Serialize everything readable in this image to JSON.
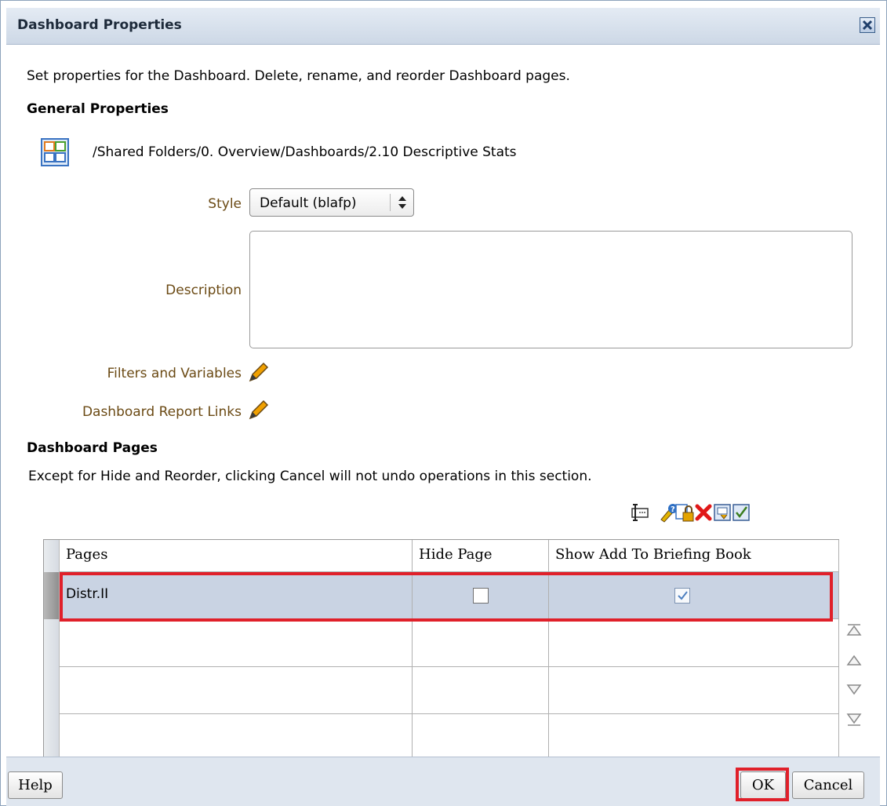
{
  "dialog": {
    "title": "Dashboard Properties",
    "close_icon": "close-icon"
  },
  "intro_text": "Set properties for the Dashboard. Delete, rename, and reorder Dashboard pages.",
  "general": {
    "heading": "General Properties",
    "path": "/Shared Folders/0. Overview/Dashboards/2.10 Descriptive Stats",
    "style_label": "Style",
    "style_value": "Default (blafp)",
    "description_label": "Description",
    "description_value": "",
    "filters_label": "Filters and Variables",
    "report_links_label": "Dashboard Report Links"
  },
  "pages_section": {
    "heading": "Dashboard Pages",
    "note": "Except for Hide and Reorder, clicking Cancel will not undo operations in this section.",
    "toolbar_icons": [
      "rename-icon",
      "properties-icon",
      "permissions-icon",
      "delete-icon",
      "print-options-icon",
      "report-links-icon"
    ],
    "columns": [
      "Pages",
      "Hide Page",
      "Show Add To Briefing Book"
    ],
    "rows": [
      {
        "page": "Distr.II",
        "hide_page": false,
        "show_briefing_book": true
      }
    ],
    "reorder_icons": [
      "move-to-top-icon",
      "move-up-icon",
      "move-down-icon",
      "move-to-bottom-icon"
    ]
  },
  "footer": {
    "help_label": "Help",
    "ok_label": "OK",
    "cancel_label": "Cancel"
  },
  "colors": {
    "highlight": "#e0202a",
    "label_brown": "#6b4a14",
    "selected_row": "#c9d3e3",
    "titlebar": "#cdd8e6"
  }
}
